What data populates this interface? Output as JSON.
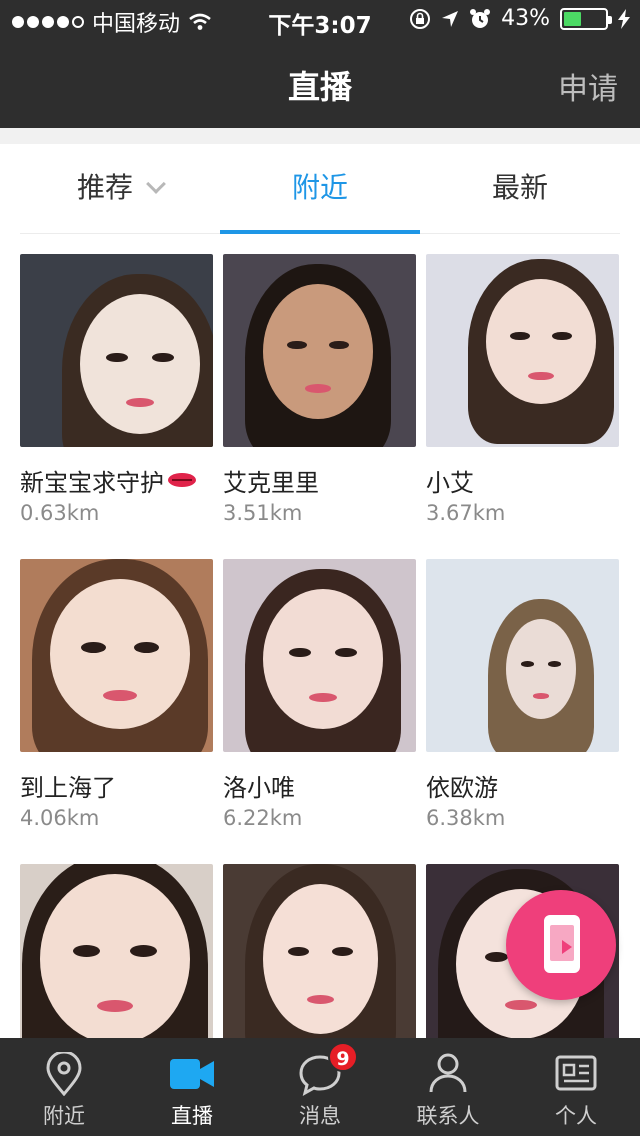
{
  "status_bar": {
    "carrier": "中国移动",
    "time": "下午3:07",
    "battery_percent": "43%",
    "battery_level": 0.43
  },
  "header": {
    "title": "直播",
    "action_label": "申请"
  },
  "tabs": [
    {
      "label": "推荐",
      "active": false
    },
    {
      "label": "附近",
      "active": true
    },
    {
      "label": "最新",
      "active": false
    }
  ],
  "streams": [
    {
      "name": "新宝宝求守护",
      "distance": "0.63km",
      "colors": {
        "bg": "#3b3f48",
        "skin": "#f0e3da",
        "hair": "#3a2b22"
      }
    },
    {
      "name": "艾克里里",
      "distance": "3.51km",
      "colors": {
        "bg": "#4b4650",
        "skin": "#c99a7c",
        "hair": "#1e1612"
      }
    },
    {
      "name": "小艾",
      "distance": "3.67km",
      "colors": {
        "bg": "#dcdde6",
        "skin": "#f2ddd4",
        "hair": "#3a2a22"
      }
    },
    {
      "name": "到上海了",
      "distance": "4.06km",
      "colors": {
        "bg": "#b07c5c",
        "skin": "#f3ddd0",
        "hair": "#5a3a28"
      }
    },
    {
      "name": "洛小唯",
      "distance": "6.22km",
      "colors": {
        "bg": "#cfc5cc",
        "skin": "#f2dcd4",
        "hair": "#3a2620"
      }
    },
    {
      "name": "依欧游",
      "distance": "6.38km",
      "colors": {
        "bg": "#dde4ec",
        "skin": "#eadcd6",
        "hair": "#7a6248"
      }
    },
    {
      "name": "",
      "distance": "",
      "colors": {
        "bg": "#d8cfc8",
        "skin": "#f3ddd2",
        "hair": "#2a1e18"
      }
    },
    {
      "name": "",
      "distance": "",
      "colors": {
        "bg": "#4a3b34",
        "skin": "#f5dfd6",
        "hair": "#3a2a22"
      }
    },
    {
      "name": "",
      "distance": "",
      "colors": {
        "bg": "#3a2f38",
        "skin": "#f4e2dc",
        "hair": "#241a18"
      }
    }
  ],
  "bottom_nav": [
    {
      "label": "附近",
      "icon": "location-pin-icon",
      "active": false
    },
    {
      "label": "直播",
      "icon": "video-camera-icon",
      "active": true
    },
    {
      "label": "消息",
      "icon": "chat-bubble-icon",
      "active": false,
      "badge": "9"
    },
    {
      "label": "联系人",
      "icon": "person-icon",
      "active": false
    },
    {
      "label": "个人",
      "icon": "profile-card-icon",
      "active": false
    }
  ],
  "fab": {
    "icon": "phone-live-icon"
  },
  "colors": {
    "accent": "#1e96e6",
    "header_bg": "#2e2e2e",
    "fab": "#ef3f7b",
    "badge": "#e61e26"
  }
}
